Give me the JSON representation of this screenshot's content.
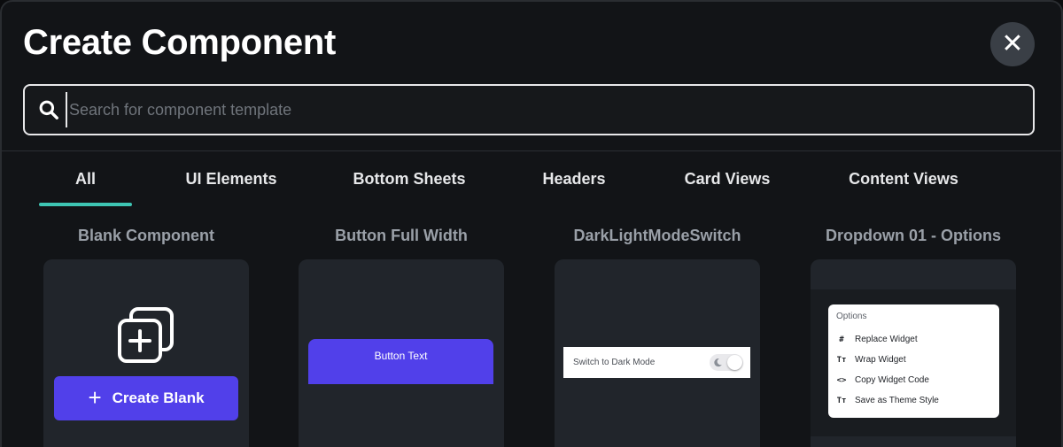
{
  "dialog": {
    "title": "Create Component",
    "close_icon": "close-icon"
  },
  "search": {
    "placeholder": "Search for component template",
    "value": "",
    "icon": "search-icon"
  },
  "tabs": [
    {
      "label": "All",
      "active": true
    },
    {
      "label": "UI Elements",
      "active": false
    },
    {
      "label": "Bottom Sheets",
      "active": false
    },
    {
      "label": "Headers",
      "active": false
    },
    {
      "label": "Card Views",
      "active": false
    },
    {
      "label": "Content Views",
      "active": false
    }
  ],
  "accent_color": "#3ec6b4",
  "primary_color": "#5140ea",
  "templates": [
    {
      "name": "Blank Component",
      "icon": "add-layers-icon",
      "button_label": "Create Blank"
    },
    {
      "name": "Button Full Width",
      "preview_text": "Button Text"
    },
    {
      "name": "DarkLightModeSwitch",
      "preview_text": "Switch to Dark Mode",
      "toggle_icon": "moon-icon"
    },
    {
      "name": "Dropdown 01 - Options",
      "options_title": "Options",
      "options": [
        {
          "label": "Replace Widget",
          "icon": "grid-icon",
          "glyph": "#"
        },
        {
          "label": "Wrap Widget",
          "icon": "text-icon",
          "glyph": "Tт"
        },
        {
          "label": "Copy Widget Code",
          "icon": "code-icon",
          "glyph": "<>"
        },
        {
          "label": "Save as Theme Style",
          "icon": "text-icon",
          "glyph": "Tт"
        }
      ]
    }
  ]
}
